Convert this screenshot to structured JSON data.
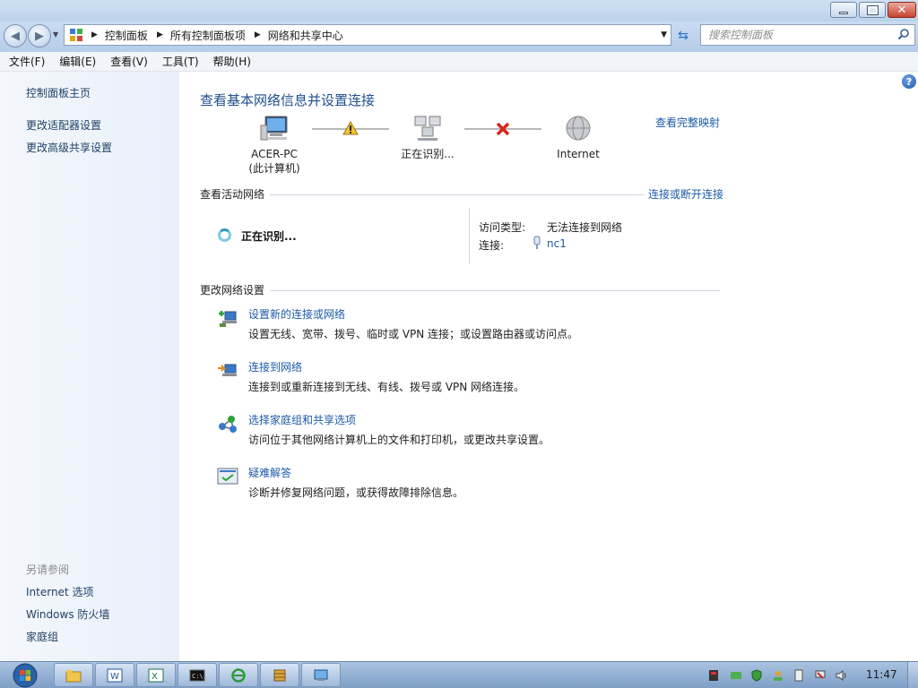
{
  "address": {
    "crumbs": [
      "控制面板",
      "所有控制面板项",
      "网络和共享中心"
    ]
  },
  "search": {
    "placeholder": "搜索控制面板"
  },
  "menu": [
    "文件(F)",
    "编辑(E)",
    "查看(V)",
    "工具(T)",
    "帮助(H)"
  ],
  "sidebar": {
    "items": [
      "控制面板主页",
      "更改适配器设置",
      "更改高级共享设置"
    ],
    "see_also_title": "另请参阅",
    "see_also": [
      "Internet 选项",
      "Windows 防火墙",
      "家庭组"
    ]
  },
  "main": {
    "title": "查看基本网络信息并设置连接",
    "full_map_link": "查看完整映射",
    "nodes": {
      "computer_name": "ACER-PC",
      "computer_sub": "(此计算机)",
      "middle": "正在识别...",
      "internet": "Internet"
    },
    "active_networks": {
      "heading": "查看活动网络",
      "connect_link": "连接或断开连接",
      "network_name": "正在识别...",
      "access_label": "访问类型:",
      "access_value": "无法连接到网络",
      "connection_label": "连接:",
      "connection_value": "nc1"
    },
    "change_settings": {
      "heading": "更改网络设置",
      "tasks": [
        {
          "title": "设置新的连接或网络",
          "desc": "设置无线、宽带、拨号、临时或 VPN 连接；或设置路由器或访问点。",
          "icon": "new-connection-icon"
        },
        {
          "title": "连接到网络",
          "desc": "连接到或重新连接到无线、有线、拨号或 VPN 网络连接。",
          "icon": "connect-network-icon"
        },
        {
          "title": "选择家庭组和共享选项",
          "desc": "访问位于其他网络计算机上的文件和打印机，或更改共享设置。",
          "icon": "homegroup-icon"
        },
        {
          "title": "疑难解答",
          "desc": "诊断并修复网络问题，或获得故障排除信息。",
          "icon": "troubleshoot-icon"
        }
      ]
    }
  },
  "taskbar": {
    "clock": "11:47",
    "apps": [
      "explorer-icon",
      "word-icon",
      "excel-icon",
      "cmd-icon",
      "ie-icon",
      "winrar-icon",
      "network-center-icon"
    ]
  },
  "colors": {
    "link": "#1c5aa8",
    "title": "#1e4e8c",
    "warning": "#f2c230",
    "error": "#d8261c"
  }
}
